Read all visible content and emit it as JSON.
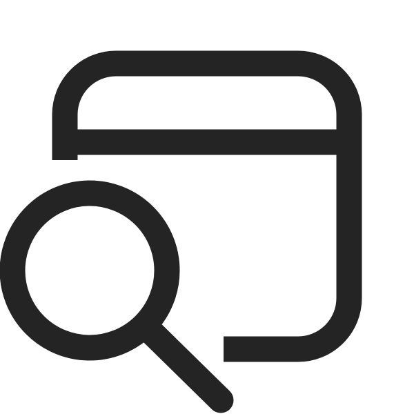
{
  "icon": {
    "name": "window-search-icon",
    "stroke_color": "#242424",
    "background_color": "#ffffff"
  }
}
